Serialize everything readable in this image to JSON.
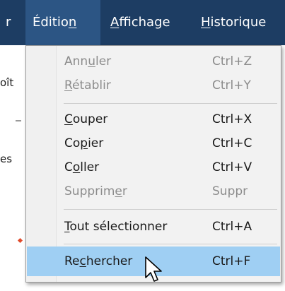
{
  "menubar": {
    "left_fragment": "r",
    "edition": "Édition",
    "affichage": "Affichage",
    "historique": "Historique"
  },
  "background": {
    "frag_1": "oît",
    "frag_2": "es"
  },
  "edit_menu": {
    "items": [
      {
        "label": "Annuler",
        "shortcut": "Ctrl+Z",
        "enabled": false
      },
      {
        "label": "Rétablir",
        "shortcut": "Ctrl+Y",
        "enabled": false
      },
      {
        "label": "Couper",
        "shortcut": "Ctrl+X",
        "enabled": true
      },
      {
        "label": "Copier",
        "shortcut": "Ctrl+C",
        "enabled": true
      },
      {
        "label": "Coller",
        "shortcut": "Ctrl+V",
        "enabled": true
      },
      {
        "label": "Supprimer",
        "shortcut": "Suppr",
        "enabled": false
      },
      {
        "label": "Tout sélectionner",
        "shortcut": "Ctrl+A",
        "enabled": true
      },
      {
        "label": "Rechercher",
        "shortcut": "Ctrl+F",
        "enabled": true,
        "highlighted": true
      }
    ]
  },
  "colors": {
    "menubar": "#1d3d63",
    "menubar_active": "#2c5584",
    "highlight": "#9fcff3",
    "disabled_text": "#8c8c8c"
  },
  "icons": {
    "cursor": "mouse-pointer-icon"
  }
}
